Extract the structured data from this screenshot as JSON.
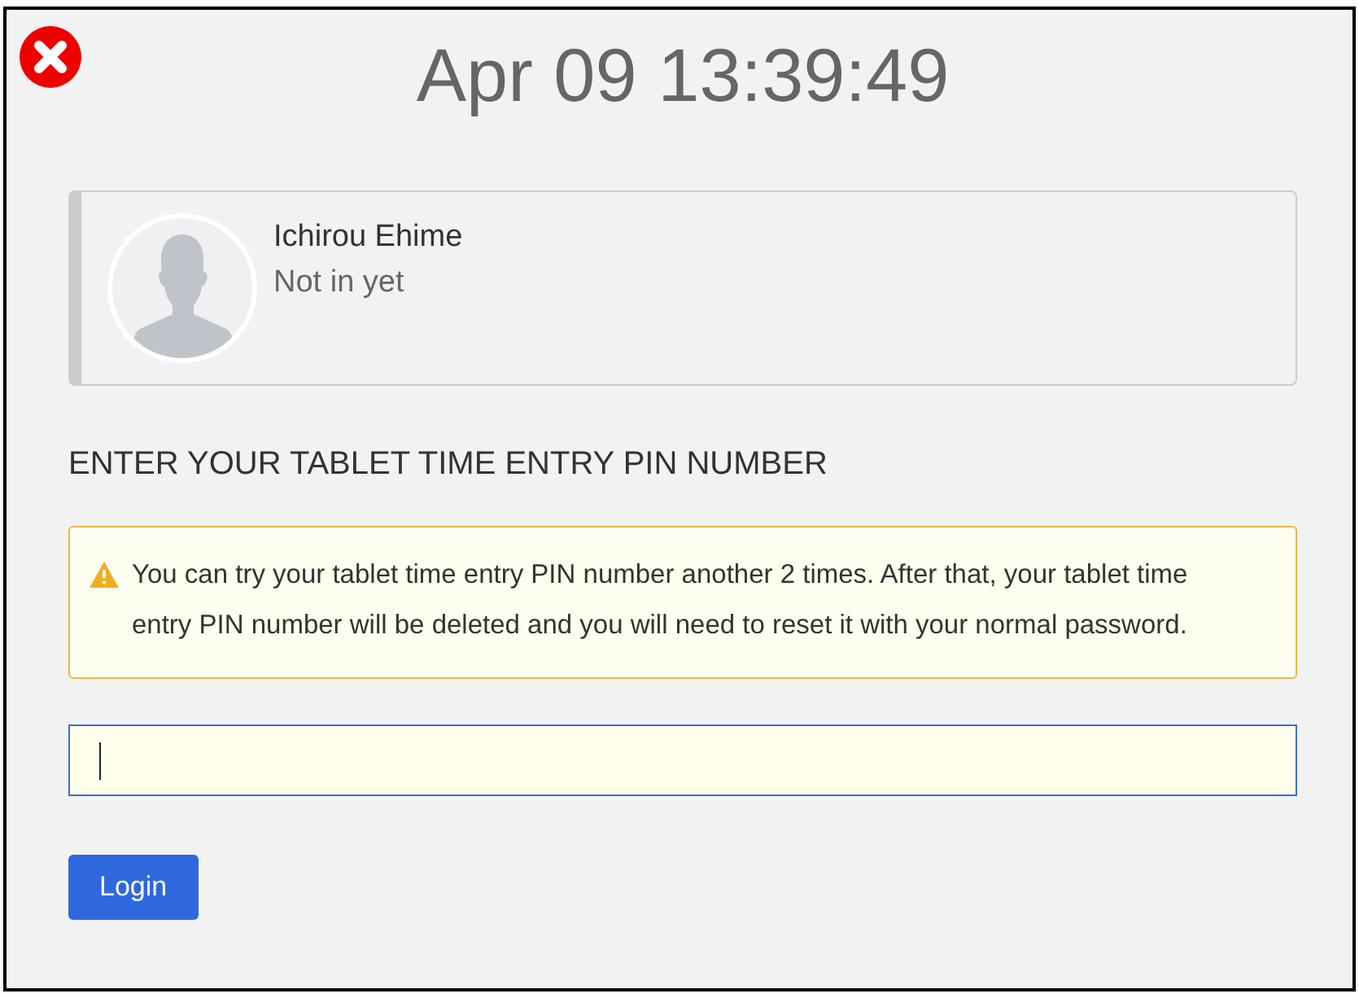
{
  "clock": "Apr 09 13:39:49",
  "employee": {
    "name": "Ichirou Ehime",
    "status": "Not in yet"
  },
  "heading": "ENTER YOUR TABLET TIME ENTRY PIN NUMBER",
  "alert": {
    "kind": "warning",
    "text": "You can try your tablet time entry PIN number another 2 times. After that, your tablet time entry PIN number will be deleted and you will need to reset it with your normal password."
  },
  "pin_field": {
    "focused": true
  },
  "login_button": "Login"
}
